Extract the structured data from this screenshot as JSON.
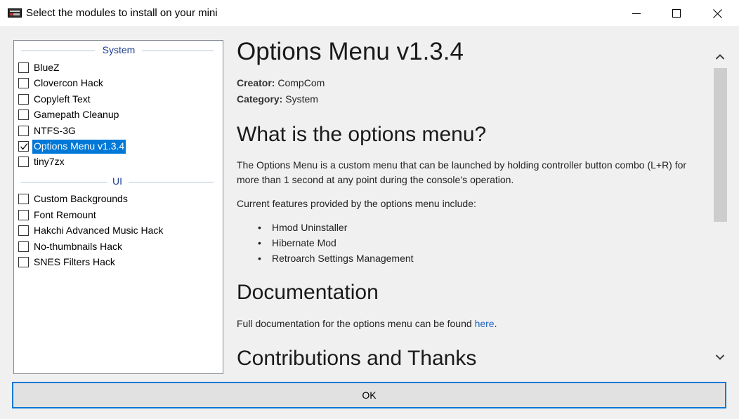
{
  "window": {
    "title": "Select the modules to install on your mini"
  },
  "module_list": {
    "groups": [
      {
        "name": "System",
        "items": [
          {
            "label": "BlueZ",
            "checked": false
          },
          {
            "label": "Clovercon Hack",
            "checked": false
          },
          {
            "label": "Copyleft Text",
            "checked": false
          },
          {
            "label": "Gamepath Cleanup",
            "checked": false
          },
          {
            "label": "NTFS-3G",
            "checked": false
          },
          {
            "label": "Options Menu v1.3.4",
            "checked": true,
            "selected": true
          },
          {
            "label": "tiny7zx",
            "checked": false
          }
        ]
      },
      {
        "name": "UI",
        "items": [
          {
            "label": "Custom Backgrounds",
            "checked": false
          },
          {
            "label": "Font Remount",
            "checked": false
          },
          {
            "label": "Hakchi Advanced Music Hack",
            "checked": false
          },
          {
            "label": "No-thumbnails Hack",
            "checked": false
          },
          {
            "label": "SNES Filters Hack",
            "checked": false
          }
        ]
      }
    ]
  },
  "details": {
    "title": "Options Menu v1.3.4",
    "creator_label": "Creator:",
    "creator": "CompCom",
    "category_label": "Category:",
    "category": "System",
    "section1_heading": "What is the options menu?",
    "section1_paragraph": "The Options Menu is a custom menu that can be launched by holding controller button combo (L+R) for more than 1 second at any point during the console’s operation.",
    "section1_features_intro": "Current features provided by the options menu include:",
    "features": [
      "Hmod Uninstaller",
      "Hibernate Mod",
      "Retroarch Settings Management"
    ],
    "section2_heading": "Documentation",
    "section2_text": "Full documentation for the options menu can be found ",
    "section2_link": "here",
    "section2_suffix": ".",
    "section3_heading": "Contributions and Thanks"
  },
  "footer": {
    "ok_label": "OK"
  },
  "colors": {
    "accent": "#0078d7",
    "link": "#1e63c0",
    "group_header": "#1e3f8f"
  }
}
